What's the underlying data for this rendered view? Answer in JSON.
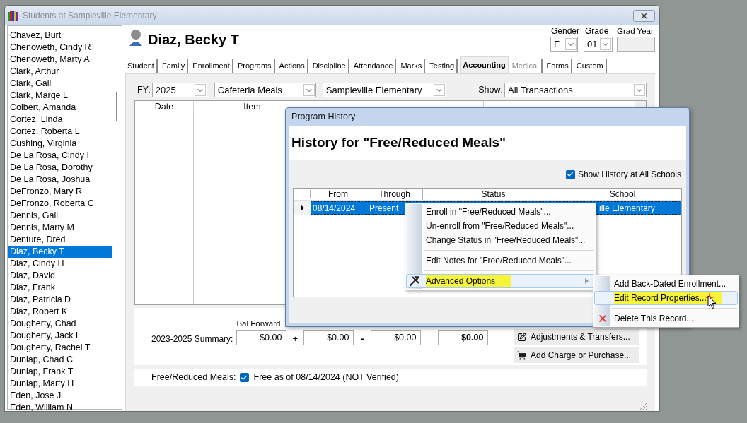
{
  "window": {
    "title": "Students at Sampleville Elementary"
  },
  "students": [
    {
      "name": "Chavez, Burt",
      "selected": false
    },
    {
      "name": "Chenoweth, Cindy R",
      "selected": false
    },
    {
      "name": "Chenoweth, Marty A",
      "selected": false
    },
    {
      "name": "Clark, Arthur",
      "selected": false
    },
    {
      "name": "Clark, Gail",
      "selected": false
    },
    {
      "name": "Clark, Marge L",
      "selected": false
    },
    {
      "name": "Colbert, Amanda",
      "selected": false
    },
    {
      "name": "Cortez, Linda",
      "selected": false
    },
    {
      "name": "Cortez, Roberta L",
      "selected": false
    },
    {
      "name": "Cushing, Virginia",
      "selected": false
    },
    {
      "name": "De La Rosa, Cindy I",
      "selected": false
    },
    {
      "name": "De La Rosa, Dorothy",
      "selected": false
    },
    {
      "name": "De La Rosa, Joshua",
      "selected": false
    },
    {
      "name": "DeFronzo, Mary R",
      "selected": false
    },
    {
      "name": "DeFronzo, Roberta C",
      "selected": false
    },
    {
      "name": "Dennis, Gail",
      "selected": false
    },
    {
      "name": "Dennis, Marty M",
      "selected": false
    },
    {
      "name": "Denture, Dred",
      "selected": false
    },
    {
      "name": "Diaz, Becky T",
      "selected": true
    },
    {
      "name": "Diaz, Cindy H",
      "selected": false
    },
    {
      "name": "Diaz, David",
      "selected": false
    },
    {
      "name": "Diaz, Frank",
      "selected": false
    },
    {
      "name": "Diaz, Patricia D",
      "selected": false
    },
    {
      "name": "Diaz, Robert K",
      "selected": false
    },
    {
      "name": "Dougherty, Chad",
      "selected": false
    },
    {
      "name": "Dougherty, Jack I",
      "selected": false
    },
    {
      "name": "Dougherty, Rachel T",
      "selected": false
    },
    {
      "name": "Dunlap, Chad C",
      "selected": false
    },
    {
      "name": "Dunlap, Frank T",
      "selected": false
    },
    {
      "name": "Dunlap, Marty H",
      "selected": false
    },
    {
      "name": "Eden, Jose J",
      "selected": false
    },
    {
      "name": "Eden, William N",
      "selected": false
    }
  ],
  "student": {
    "name": "Diaz, Becky T",
    "gender": {
      "label": "Gender",
      "value": "F"
    },
    "grade": {
      "label": "Grade",
      "value": "01"
    },
    "grad_year": {
      "label": "Grad Year"
    }
  },
  "tabs": [
    {
      "label": "Student",
      "selected": false,
      "disabled": false
    },
    {
      "label": "Family",
      "selected": false,
      "disabled": false
    },
    {
      "label": "Enrollment",
      "selected": false,
      "disabled": false
    },
    {
      "label": "Programs",
      "selected": false,
      "disabled": false
    },
    {
      "label": "Actions",
      "selected": false,
      "disabled": false
    },
    {
      "label": "Discipline",
      "selected": false,
      "disabled": false
    },
    {
      "label": "Attendance",
      "selected": false,
      "disabled": false
    },
    {
      "label": "Marks",
      "selected": false,
      "disabled": false
    },
    {
      "label": "Testing",
      "selected": false,
      "disabled": false
    },
    {
      "label": "Accounting",
      "selected": true,
      "disabled": false
    },
    {
      "label": "Medical",
      "selected": false,
      "disabled": true
    },
    {
      "label": "Forms",
      "selected": false,
      "disabled": false
    },
    {
      "label": "Custom",
      "selected": false,
      "disabled": false
    }
  ],
  "filters": {
    "fy_label": "FY:",
    "fy": "2025",
    "category": "Cafeteria Meals",
    "school": "Sampleville Elementary",
    "show_label": "Show:",
    "show": "All Transactions"
  },
  "table": {
    "columns": [
      "Date",
      "Item"
    ]
  },
  "summary": {
    "label": "2023-2025 Summary:",
    "bal_forward_label": "Bal Forward",
    "values": [
      "$0.00",
      "$0.00",
      "$0.00",
      "$0.00"
    ],
    "operators": [
      "+",
      "-",
      "="
    ]
  },
  "buttons": [
    {
      "kind": "edit",
      "label": "Adjustments & Transfers..."
    },
    {
      "kind": "cart",
      "label": "Add Charge or Purchase..."
    }
  ],
  "free_reduced": {
    "label": "Free/Reduced Meals:",
    "checked": true,
    "text": "Free as of 08/14/2024 (NOT Verified)"
  },
  "dialog": {
    "title": "Program History",
    "heading": "History for \"Free/Reduced Meals\"",
    "show_all": {
      "label": "Show History at All Schools",
      "checked": true
    },
    "columns": [
      "From",
      "Through",
      "Status",
      "School"
    ],
    "rows": [
      {
        "selected": true,
        "from": "08/14/2024",
        "through": "Present",
        "school": "ille Elementary"
      }
    ]
  },
  "context_menu": [
    {
      "kind": "item",
      "label": "Enroll in \"Free/Reduced Meals\"...",
      "hovered": false,
      "highlighted": false
    },
    {
      "kind": "item",
      "label": "Un-enroll from \"Free/Reduced Meals\"...",
      "hovered": false,
      "highlighted": false
    },
    {
      "kind": "item",
      "label": "Change Status in \"Free/Reduced Meals\"...",
      "hovered": false,
      "highlighted": false
    },
    {
      "kind": "separator"
    },
    {
      "kind": "item",
      "label": "Edit Notes for \"Free/Reduced Meals\"...",
      "hovered": false,
      "highlighted": false
    },
    {
      "kind": "separator"
    },
    {
      "kind": "submenu",
      "label": "Advanced Options",
      "hovered": true,
      "highlighted": true
    }
  ],
  "submenu": [
    {
      "kind": "item",
      "label": "Add Back-Dated Enrollment...",
      "hovered": false,
      "highlighted": false
    },
    {
      "kind": "item",
      "label": "Edit Record Properties...",
      "hovered": true,
      "highlighted": true
    },
    {
      "kind": "separator"
    },
    {
      "kind": "delete",
      "label": "Delete This Record...",
      "hovered": false,
      "highlighted": false
    }
  ]
}
